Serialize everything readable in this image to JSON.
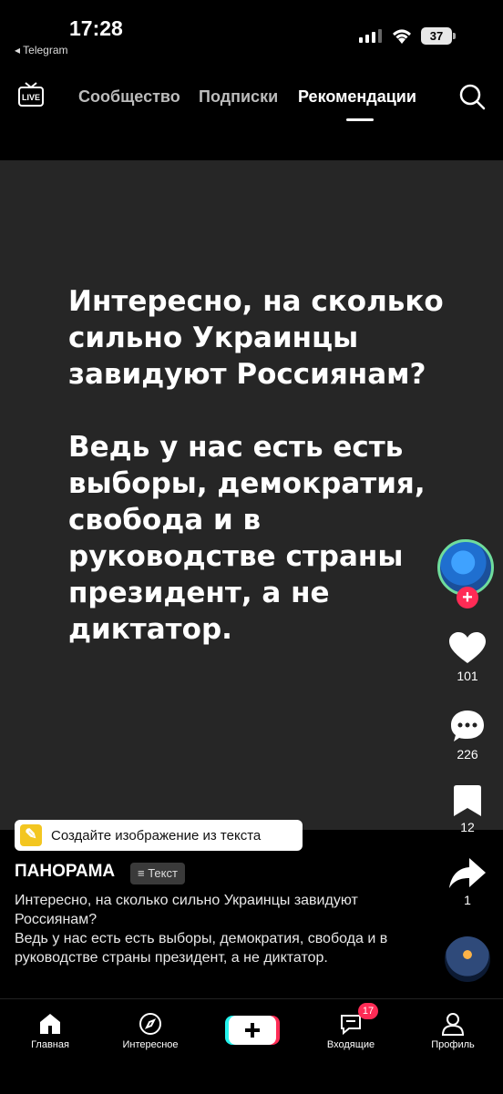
{
  "status_bar": {
    "time": "17:28",
    "back_app": "◂ Telegram",
    "battery": "37"
  },
  "top_nav": {
    "live_label": "LIVE",
    "tabs": [
      {
        "label": "Сообщество"
      },
      {
        "label": "Подписки"
      },
      {
        "label": "Рекомендации"
      }
    ]
  },
  "video": {
    "paragraph1": "Интересно, на сколько сильно Украинцы завидуют Россиянам?",
    "paragraph2": "Ведь у нас есть есть выборы, демократия, свобода и в руководстве страны президент, а не диктатор."
  },
  "actions": {
    "likes": "101",
    "comments": "226",
    "saves": "12",
    "shares": "1"
  },
  "ai_banner": {
    "text": "Создайте изображение из текста"
  },
  "post": {
    "author": "ПАНОРАМА",
    "badge": "Текст",
    "caption": "Интересно, на сколько сильно Украинцы завидуют Россиянам?\nВедь у нас есть есть выборы, демократия, свобода и в руководстве страны президент, а не диктатор."
  },
  "bottom_nav": {
    "home": "Главная",
    "discover": "Интересное",
    "inbox": "Входящие",
    "inbox_badge": "17",
    "profile": "Профиль"
  },
  "colors": {
    "accent": "#ff2b55",
    "background": "#000000",
    "video_bg": "#262626"
  }
}
